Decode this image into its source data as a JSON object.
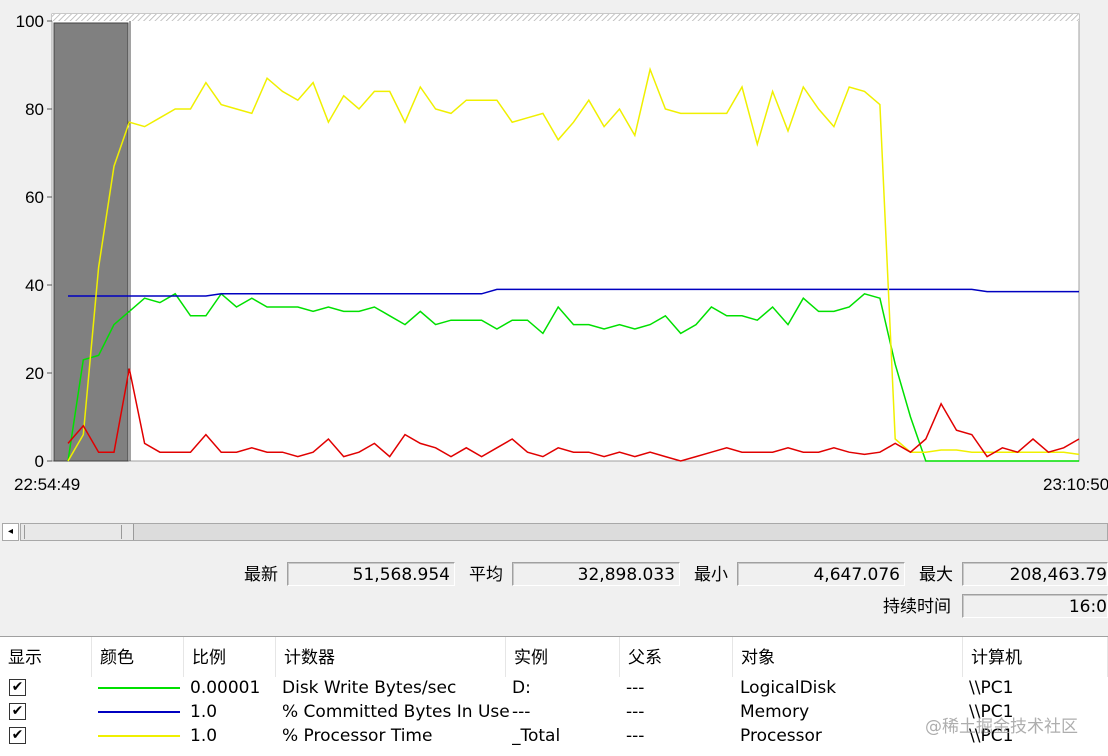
{
  "chart_data": {
    "type": "line",
    "ylim": [
      0,
      100
    ],
    "y_ticks": [
      "0",
      "20",
      "40",
      "60",
      "80",
      "100"
    ],
    "x_range_labels": {
      "start": "22:54:49",
      "end": "23:10:50"
    },
    "grid": false,
    "series": [
      {
        "color": "#00e000",
        "values": [
          0,
          23,
          24,
          31,
          34,
          37,
          36,
          38,
          33,
          33,
          38,
          35,
          37,
          35,
          35,
          35,
          34,
          35,
          34,
          34,
          35,
          33,
          31,
          34,
          31,
          32,
          32,
          32,
          30,
          32,
          32,
          29,
          35,
          31,
          31,
          30,
          31,
          30,
          31,
          33,
          29,
          31,
          35,
          33,
          33,
          32,
          35,
          31,
          37,
          34,
          34,
          35,
          38,
          37,
          22,
          10,
          0,
          0,
          0,
          0,
          0,
          0,
          0,
          0,
          0,
          0,
          0
        ]
      },
      {
        "color": "#0000c0",
        "values": [
          37.5,
          37.5,
          37.5,
          37.5,
          37.5,
          37.5,
          37.5,
          37.5,
          37.5,
          37.5,
          38,
          38,
          38,
          38,
          38,
          38,
          38,
          38,
          38,
          38,
          38,
          38,
          38,
          38,
          38,
          38,
          38,
          38,
          39,
          39,
          39,
          39,
          39,
          39,
          39,
          39,
          39,
          39,
          39,
          39,
          39,
          39,
          39,
          39,
          39,
          39,
          39,
          39,
          39,
          39,
          39,
          39,
          39,
          39,
          39,
          39,
          39,
          39,
          39,
          39,
          38.5,
          38.5,
          38.5,
          38.5,
          38.5,
          38.5,
          38.5
        ]
      },
      {
        "color": "#f0f000",
        "values": [
          0,
          6,
          44,
          67,
          77,
          76,
          78,
          80,
          80,
          86,
          81,
          80,
          79,
          87,
          84,
          82,
          86,
          77,
          83,
          80,
          84,
          84,
          77,
          85,
          80,
          79,
          82,
          82,
          82,
          77,
          78,
          79,
          73,
          77,
          82,
          76,
          80,
          74,
          89,
          80,
          79,
          79,
          79,
          79,
          85,
          72,
          84,
          75,
          85,
          80,
          76,
          85,
          84,
          81,
          5,
          2,
          2,
          2.5,
          2.5,
          2,
          2,
          2,
          2,
          2,
          2,
          2,
          1.5
        ]
      },
      {
        "color": "#e00000",
        "values": [
          4,
          8,
          2,
          2,
          21,
          4,
          2,
          2,
          2,
          6,
          2,
          2,
          3,
          2,
          2,
          1,
          2,
          5,
          1,
          2,
          4,
          1,
          6,
          4,
          3,
          1,
          3,
          1,
          3,
          5,
          2,
          1,
          3,
          2,
          2,
          1,
          2,
          1,
          2,
          1,
          0,
          1,
          2,
          3,
          2,
          2,
          2,
          3,
          2,
          2,
          3,
          2,
          1.5,
          2,
          4,
          2,
          5,
          13,
          7,
          6,
          1,
          3,
          2,
          5,
          2,
          3,
          5
        ]
      }
    ]
  },
  "stats": {
    "latest_label": "最新",
    "latest_value": "51,568.954",
    "avg_label": "平均",
    "avg_value": "32,898.033",
    "min_label": "最小",
    "min_value": "4,647.076",
    "max_label": "最大",
    "max_value": "208,463.79",
    "duration_label": "持续时间",
    "duration_value": "16:0"
  },
  "legend": {
    "headers": [
      "显示",
      "颜色",
      "比例",
      "计数器",
      "实例",
      "父系",
      "对象",
      "计算机"
    ],
    "rows": [
      {
        "checked": "✔",
        "color": "#00e000",
        "scale": "0.00001",
        "counter": "Disk Write Bytes/sec",
        "instance": "D:",
        "parent": "---",
        "object": "LogicalDisk",
        "computer": "\\\\PC1"
      },
      {
        "checked": "✔",
        "color": "#0000c0",
        "scale": "1.0",
        "counter": "% Committed Bytes In Use",
        "instance": "---",
        "parent": "---",
        "object": "Memory",
        "computer": "\\\\PC1"
      },
      {
        "checked": "✔",
        "color": "#f0f000",
        "scale": "1.0",
        "counter": "% Processor Time",
        "instance": "_Total",
        "parent": "---",
        "object": "Processor",
        "computer": "\\\\PC1"
      }
    ]
  },
  "watermark": "@稀土掘金技术社区",
  "scrollbar": {
    "left_arrow": "◂"
  }
}
